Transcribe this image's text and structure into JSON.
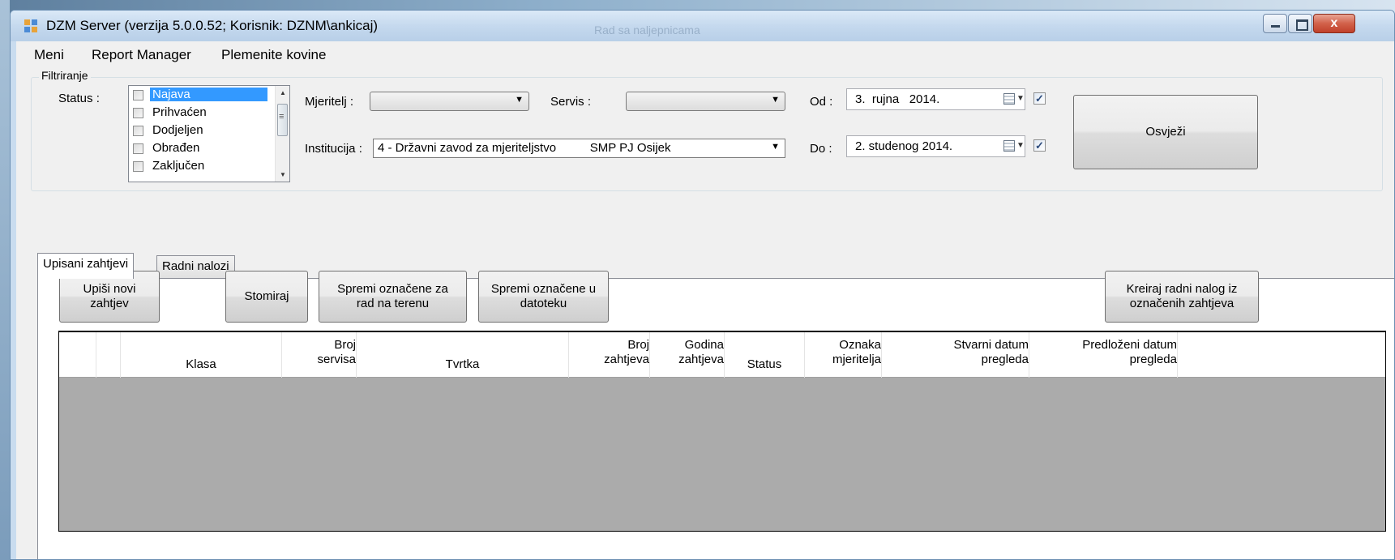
{
  "window": {
    "title": "DZM Server (verzija 5.0.0.52; Korisnik: DZNM\\ankicaj)",
    "background_title": "Rad sa naljepnicama",
    "close_label": "x"
  },
  "menu": [
    "Meni",
    "Report Manager",
    "Plemenite kovine"
  ],
  "filter": {
    "group_label": "Filtriranje",
    "status_label": "Status :",
    "status_items": [
      "Najava",
      "Prihvaćen",
      "Dodjeljen",
      "Obrađen",
      "Zaključen"
    ],
    "status_selected": "Najava",
    "mjeritelj_label": "Mjeritelj :",
    "mjeritelj_value": "",
    "servis_label": "Servis :",
    "servis_value": "",
    "institucija_label": "Institucija :",
    "institucija_value": "4 - Državni zavod za mjeriteljstvo          SMP PJ Osijek",
    "od_label": "Od :",
    "od_value": "3.  rujna   2014.",
    "od_checked": true,
    "do_label": "Do :",
    "do_value": "2. studenog 2014.",
    "do_checked": true,
    "refresh_label": "Osvježi"
  },
  "tabs": [
    "Upisani zahtjevi",
    "Radni nalozi"
  ],
  "active_tab": "Upisani zahtjevi",
  "actions": {
    "new_request": "Upiši novi\nzahtjev",
    "cancel": "Stomiraj",
    "save_field": "Spremi označene za\nrad na terenu",
    "save_file": "Spremi označene u\ndatoteku",
    "create_order": "Kreiraj radni nalog iz\noznačenih zahtjeva"
  },
  "grid": {
    "columns": [
      {
        "line1": "",
        "line2": "Klasa"
      },
      {
        "line1": "Broj",
        "line2": "servisa"
      },
      {
        "line1": "",
        "line2": "Tvrtka"
      },
      {
        "line1": "Broj",
        "line2": "zahtjeva"
      },
      {
        "line1": "Godina",
        "line2": "zahtjeva"
      },
      {
        "line1": "",
        "line2": "Status"
      },
      {
        "line1": "Oznaka",
        "line2": "mjeritelja"
      },
      {
        "line1": "Stvarni datum",
        "line2": "pregleda"
      },
      {
        "line1": "Predloženi datum",
        "line2": "pregleda"
      }
    ],
    "rows": []
  },
  "colors": {
    "selection": "#3399ff",
    "grid_empty": "#ababab",
    "window_frame": "#c9dcef",
    "close_button": "#c0412b"
  }
}
